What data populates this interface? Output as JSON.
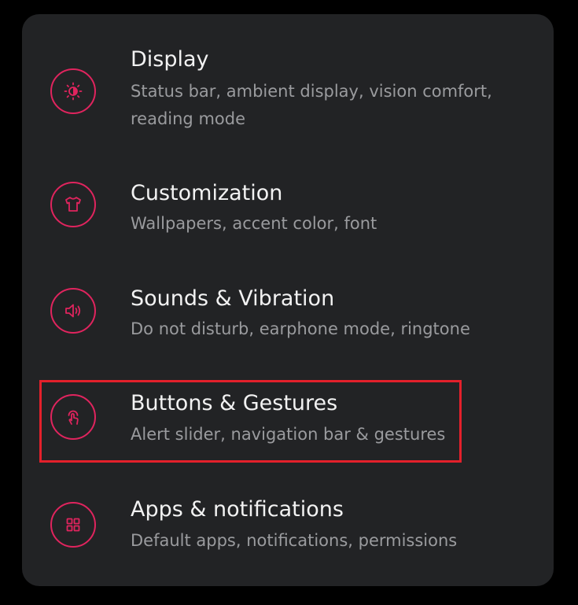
{
  "accent_color": "#e0245e",
  "highlight_color": "#e3202b",
  "items": [
    {
      "title": "Display",
      "subtitle": "Status bar, ambient display, vision comfort, reading mode",
      "icon": "brightness-icon"
    },
    {
      "title": "Customization",
      "subtitle": "Wallpapers, accent color, font",
      "icon": "tshirt-icon"
    },
    {
      "title": "Sounds & Vibration",
      "subtitle": "Do not disturb, earphone mode, ringtone",
      "icon": "speaker-icon"
    },
    {
      "title": "Buttons & Gestures",
      "subtitle": "Alert slider, navigation bar & gestures",
      "icon": "touch-gesture-icon",
      "highlighted": true
    },
    {
      "title": "Apps & notifications",
      "subtitle": "Default apps, notifications, permissions",
      "icon": "apps-grid-icon"
    }
  ]
}
